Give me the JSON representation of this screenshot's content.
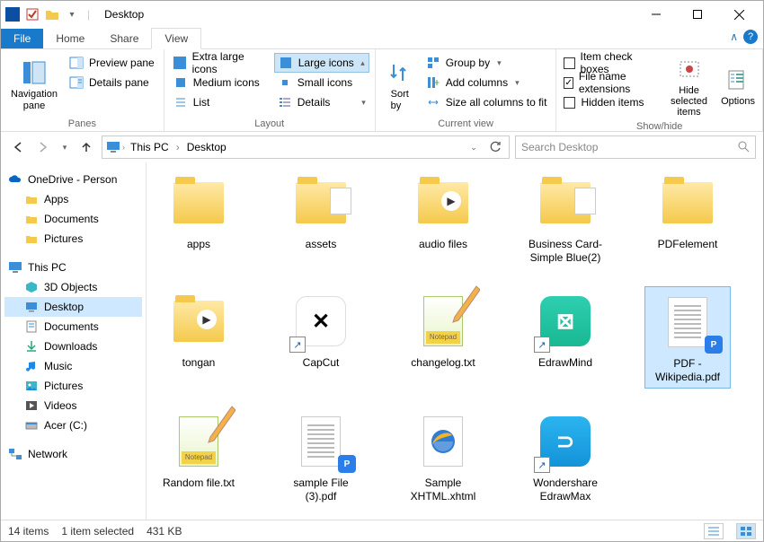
{
  "title": "Desktop",
  "tabs": {
    "file": "File",
    "home": "Home",
    "share": "Share",
    "view": "View"
  },
  "ribbon": {
    "panes": {
      "navigation_pane": "Navigation\npane",
      "preview_pane": "Preview pane",
      "details_pane": "Details pane",
      "label": "Panes"
    },
    "layout": {
      "extra_large": "Extra large icons",
      "large": "Large icons",
      "medium": "Medium icons",
      "small": "Small icons",
      "list": "List",
      "details": "Details",
      "label": "Layout"
    },
    "currentview": {
      "sort_by": "Sort\nby",
      "group_by": "Group by",
      "add_columns": "Add columns",
      "size_all": "Size all columns to fit",
      "label": "Current view"
    },
    "showhide": {
      "item_check": "Item check boxes",
      "file_ext": "File name extensions",
      "hidden": "Hidden items",
      "hide_selected": "Hide selected\nitems",
      "options": "Options",
      "label": "Show/hide"
    }
  },
  "breadcrumb": {
    "root": "This PC",
    "leaf": "Desktop"
  },
  "search": {
    "placeholder": "Search Desktop"
  },
  "tree": {
    "onedrive": "OneDrive - Person",
    "apps": "Apps",
    "documents": "Documents",
    "pictures": "Pictures",
    "thispc": "This PC",
    "objects3d": "3D Objects",
    "desktop": "Desktop",
    "documents2": "Documents",
    "downloads": "Downloads",
    "music": "Music",
    "pictures2": "Pictures",
    "videos": "Videos",
    "acer": "Acer (C:)",
    "network": "Network"
  },
  "files": [
    {
      "name": "apps",
      "kind": "folder"
    },
    {
      "name": "assets",
      "kind": "folder-doc"
    },
    {
      "name": "audio files",
      "kind": "folder-media"
    },
    {
      "name": "Business Card-Simple Blue(2)",
      "kind": "folder-doc"
    },
    {
      "name": "PDFelement",
      "kind": "folder"
    },
    {
      "name": "tongan",
      "kind": "folder-media"
    },
    {
      "name": "CapCut",
      "kind": "app-capcut"
    },
    {
      "name": "changelog.txt",
      "kind": "notepadpp"
    },
    {
      "name": "EdrawMind",
      "kind": "app-edrawmind"
    },
    {
      "name": "PDF - Wikipedia.pdf",
      "kind": "pdf-doc",
      "selected": true
    },
    {
      "name": "Random file.txt",
      "kind": "notepadpp"
    },
    {
      "name": "sample File (3).pdf",
      "kind": "pdf-doc"
    },
    {
      "name": "Sample XHTML.xhtml",
      "kind": "ie"
    },
    {
      "name": "Wondershare EdrawMax",
      "kind": "app-edrawmax"
    }
  ],
  "status": {
    "count": "14 items",
    "selection": "1 item selected",
    "size": "431 KB"
  }
}
